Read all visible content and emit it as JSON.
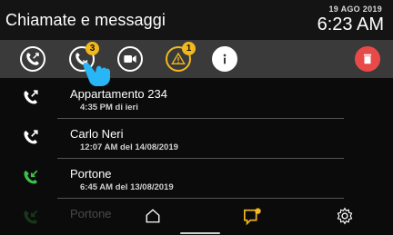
{
  "header": {
    "title": "Chiamate e messaggi",
    "date": "19 AGO 2019",
    "time": "6:23 AM"
  },
  "toolbar": {
    "buttons": [
      {
        "name": "call-transfer-icon",
        "badge": null
      },
      {
        "name": "missed-call-icon",
        "badge": "3"
      },
      {
        "name": "video-icon",
        "badge": null
      },
      {
        "name": "warning-icon",
        "badge": "1"
      },
      {
        "name": "info-icon",
        "badge": null
      },
      {
        "name": "trash-icon",
        "badge": null
      }
    ],
    "accent": "#f2b91d",
    "delete_color": "#e84a4a"
  },
  "calls": [
    {
      "name": "Appartamento 234",
      "detail": "4:35 PM di ieri",
      "icon": "outgoing-call-icon",
      "icon_color": "#ffffff"
    },
    {
      "name": "Carlo Neri",
      "detail": "12:07 AM del 14/08/2019",
      "icon": "outgoing-call-icon",
      "icon_color": "#ffffff"
    },
    {
      "name": "Portone",
      "detail": "6:45 AM del 13/08/2019",
      "icon": "incoming-call-icon",
      "icon_color": "#3cc24a"
    },
    {
      "name": "Portone",
      "detail": "",
      "icon": "incoming-call-icon",
      "icon_color": "#3cc24a"
    }
  ],
  "nav": {
    "items": [
      "home-icon",
      "messages-icon",
      "settings-icon"
    ],
    "active_color": "#f2b91d"
  }
}
